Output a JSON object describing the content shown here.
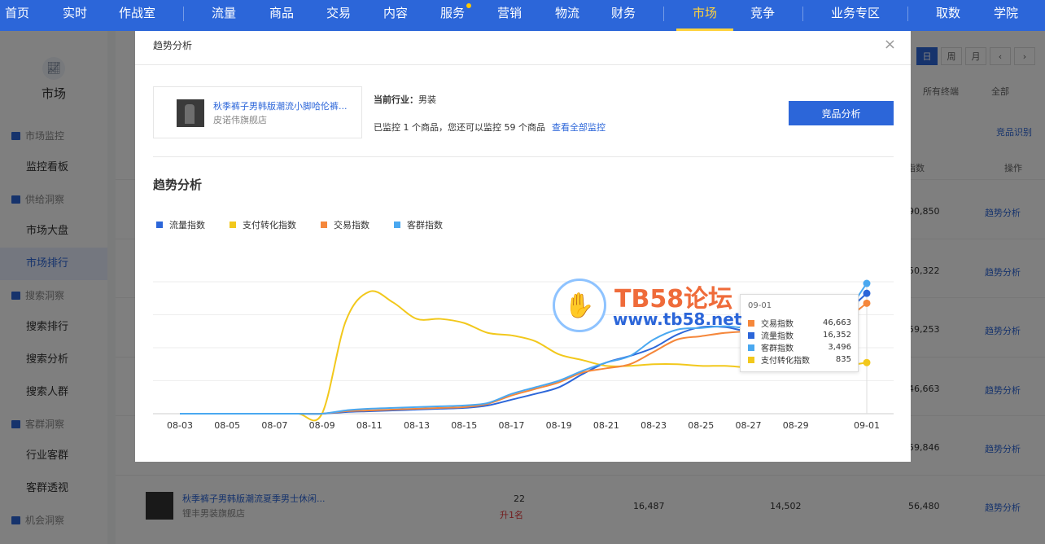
{
  "topnav": {
    "items": [
      {
        "label": "首页"
      },
      {
        "label": "实时"
      },
      {
        "label": "作战室"
      },
      {
        "label": "流量"
      },
      {
        "label": "商品"
      },
      {
        "label": "交易"
      },
      {
        "label": "内容"
      },
      {
        "label": "服务"
      },
      {
        "label": "营销"
      },
      {
        "label": "物流"
      },
      {
        "label": "财务"
      },
      {
        "label": "市场"
      },
      {
        "label": "竞争"
      },
      {
        "label": "业务专区"
      },
      {
        "label": "取数"
      },
      {
        "label": "学院"
      }
    ],
    "active": "市场",
    "accent": "#2c66d9",
    "active_color": "#ffd23c"
  },
  "sidebar": {
    "title": "市场",
    "groups": [
      {
        "label": "市场监控",
        "items": [
          "监控看板"
        ]
      },
      {
        "label": "供给洞察",
        "items": [
          "市场大盘",
          "市场排行"
        ]
      },
      {
        "label": "搜索洞察",
        "items": [
          "搜索排行",
          "搜索分析",
          "搜索人群"
        ]
      },
      {
        "label": "客群洞察",
        "items": [
          "行业客群",
          "客群透视"
        ]
      },
      {
        "label": "机会洞察",
        "items": []
      }
    ],
    "active_item": "市场排行"
  },
  "background": {
    "toolbar": [
      "日",
      "周",
      "月",
      "‹",
      "›"
    ],
    "filters": [
      "所有终端",
      "全部"
    ],
    "ident_link": "竞品识别",
    "col_index": "指数",
    "col_action": "操作",
    "row_values": [
      "90,850",
      "50,322",
      "59,253",
      "46,663",
      "59,846"
    ],
    "action_label": "趋势分析",
    "last_row": {
      "title": "秋季裤子男韩版潮流夏季男士休闲...",
      "shop": "锂丰男装旗舰店",
      "rank": "22",
      "rank_change": "升1名",
      "v1": "16,487",
      "v2": "14,502",
      "v3": "56,480"
    }
  },
  "modal": {
    "title": "趋势分析",
    "close_icon": "close-icon",
    "product": {
      "title": "秋季裤子男韩版潮流小脚哈伦裤...",
      "shop": "皮诺伟旗舰店"
    },
    "industry_label": "当前行业：",
    "industry_value": "男装",
    "monitor_text": "已监控 1 个商品，您还可以监控 59 个商品",
    "monitor_link": "查看全部监控",
    "compare_button": "竞品分析",
    "section_title": "趋势分析"
  },
  "tooltip": {
    "date": "09-01",
    "rows": [
      {
        "name": "交易指数",
        "value": "46,663",
        "color": "#f5873b"
      },
      {
        "name": "流量指数",
        "value": "16,352",
        "color": "#2c66d9"
      },
      {
        "name": "客群指数",
        "value": "3,496",
        "color": "#4aa8f0"
      },
      {
        "name": "支付转化指数",
        "value": "835",
        "color": "#f2c81c"
      }
    ]
  },
  "watermark": {
    "title": "TB58论坛",
    "url": "www.tb58.net"
  },
  "chart_data": {
    "type": "line",
    "x": [
      "08-03",
      "08-04",
      "08-05",
      "08-06",
      "08-07",
      "08-08",
      "08-09",
      "08-10",
      "08-11",
      "08-12",
      "08-13",
      "08-14",
      "08-15",
      "08-16",
      "08-17",
      "08-18",
      "08-19",
      "08-20",
      "08-21",
      "08-22",
      "08-23",
      "08-24",
      "08-25",
      "08-26",
      "08-27",
      "08-28",
      "08-29",
      "08-30",
      "08-31",
      "09-01"
    ],
    "tick_labels": [
      "08-03",
      "08-05",
      "08-07",
      "08-09",
      "08-11",
      "08-13",
      "08-15",
      "08-17",
      "08-19",
      "08-21",
      "08-23",
      "08-25",
      "08-27",
      "08-29",
      "09-01"
    ],
    "series": [
      {
        "name": "流量指数",
        "color": "#2c66d9",
        "values": [
          0,
          0,
          0,
          0,
          0,
          0,
          0,
          2,
          3,
          4,
          5,
          6,
          7,
          10,
          17,
          24,
          32,
          48,
          62,
          70,
          80,
          96,
          105,
          105,
          100,
          102,
          108,
          112,
          122,
          146
        ]
      },
      {
        "name": "支付转化指数",
        "color": "#f2c81c",
        "values": [
          0,
          0,
          0,
          0,
          0,
          0,
          0,
          112,
          148,
          135,
          115,
          115,
          110,
          98,
          95,
          88,
          72,
          65,
          58,
          58,
          60,
          60,
          58,
          58,
          56,
          55,
          55,
          58,
          58,
          62
        ]
      },
      {
        "name": "交易指数",
        "color": "#f5873b",
        "values": [
          0,
          0,
          0,
          0,
          0,
          0,
          0,
          3,
          4,
          5,
          6,
          7,
          8,
          12,
          22,
          30,
          38,
          50,
          55,
          60,
          75,
          90,
          94,
          98,
          100,
          102,
          105,
          110,
          114,
          134
        ]
      },
      {
        "name": "客群指数",
        "color": "#4aa8f0",
        "values": [
          0,
          0,
          0,
          0,
          0,
          0,
          0,
          4,
          6,
          7,
          8,
          9,
          10,
          13,
          24,
          32,
          40,
          52,
          62,
          70,
          90,
          102,
          104,
          106,
          104,
          106,
          108,
          112,
          120,
          158
        ]
      }
    ],
    "ylim": [
      0,
      160
    ],
    "grid": true,
    "legend": "top-left"
  }
}
